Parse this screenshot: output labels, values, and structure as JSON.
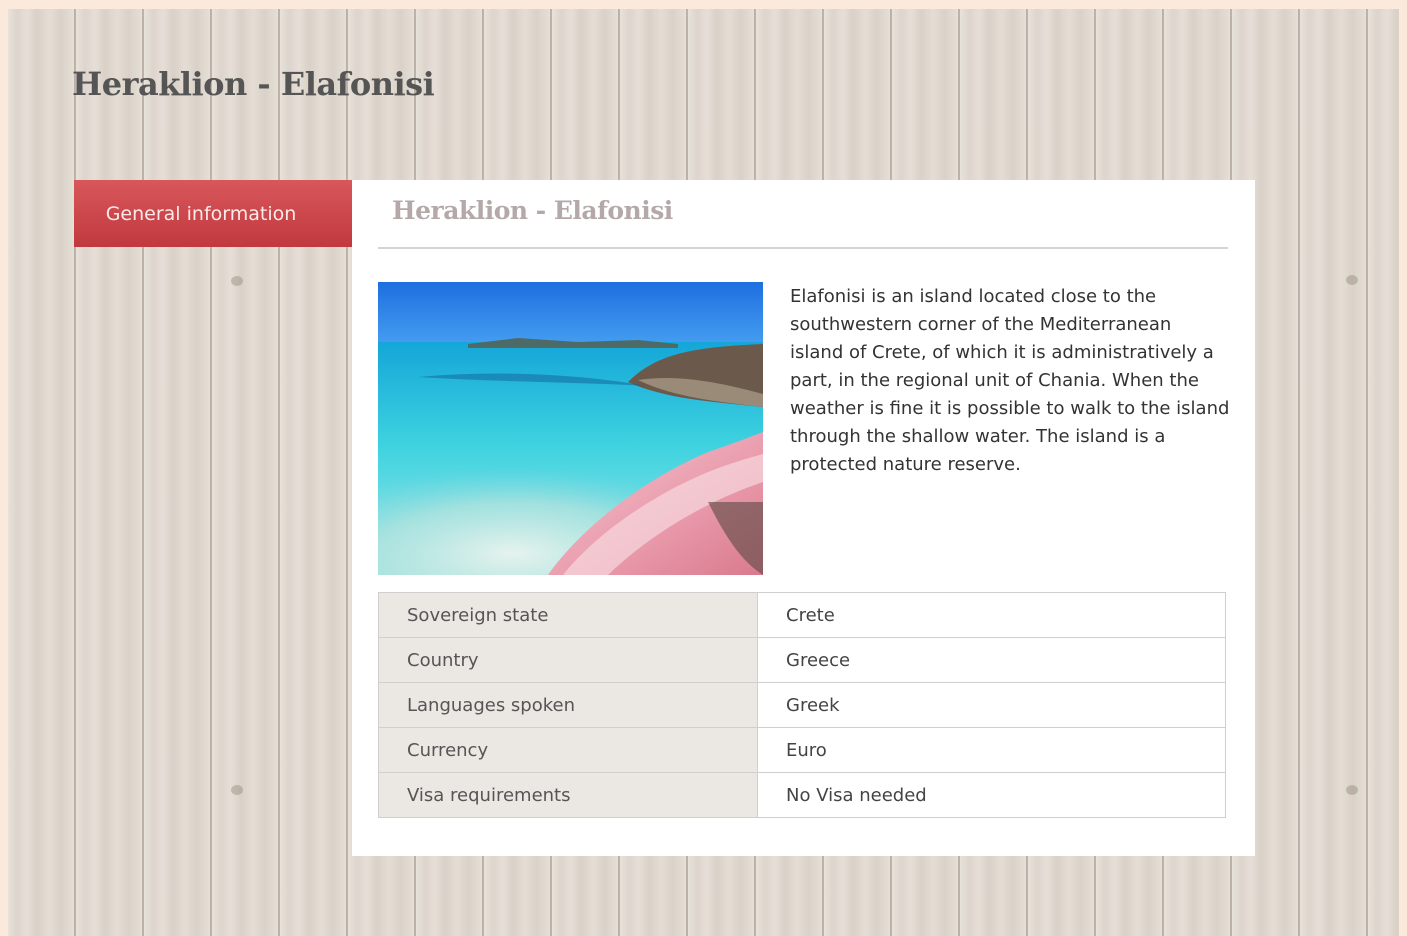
{
  "page": {
    "title": "Heraklion - Elafonisi"
  },
  "tabs": [
    {
      "label": "General information",
      "active": true
    }
  ],
  "panel": {
    "title": "Heraklion - Elafonisi",
    "description": "Elafonisi is an island located close to the southwestern corner of the Mediterranean island of Crete, of which it is administratively a part, in the regional unit of Chania. When the weather is fine it is possible to walk to the island through the shallow water. The island is a protected nature reserve."
  },
  "info_table": [
    {
      "label": "Sovereign state",
      "value": "Crete"
    },
    {
      "label": "Country",
      "value": "Greece"
    },
    {
      "label": "Languages spoken",
      "value": "Greek"
    },
    {
      "label": "Currency",
      "value": "Euro"
    },
    {
      "label": "Visa requirements",
      "value": "No Visa needed"
    }
  ],
  "colors": {
    "tab_accent": "#c9464a",
    "page_title": "#555555",
    "panel_title": "#b5a8a8",
    "page_border": "#fbe9dc"
  }
}
